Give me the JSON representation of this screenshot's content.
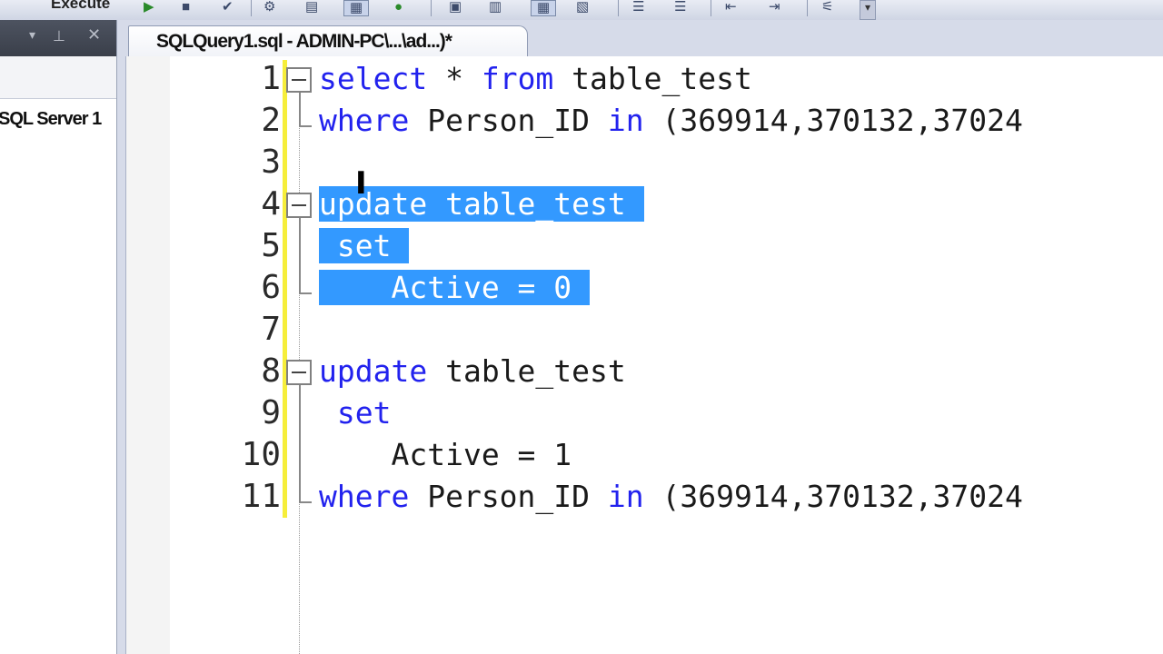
{
  "toolbar": {
    "execute_label": "Execute",
    "icons": [
      "run-icon",
      "stop-icon",
      "parse-icon",
      "check-icon",
      "db-icon",
      "grid-icon",
      "text-icon",
      "results-icon",
      "indent-icon",
      "outdent-icon",
      "comment-icon",
      "uncomment-icon",
      "specify-values-icon"
    ]
  },
  "left_panel": {
    "server_node": "SQL Server 1"
  },
  "tab": {
    "title": "SQLQuery1.sql - ADMIN-PC\\...\\ad...)*"
  },
  "editor": {
    "colors": {
      "keyword": "#2222ee",
      "selection": "#3399ff",
      "change_bar": "#f6ee3a"
    },
    "lines": [
      {
        "no": "1",
        "kw1": "select",
        "t1": " * ",
        "kw2": "from",
        "t2": " table_test",
        "selected": false
      },
      {
        "no": "2",
        "kw1": "where",
        "t1": " Person_ID ",
        "kw2": "in",
        "t2": " (369914,370132,37024",
        "selected": false
      },
      {
        "no": "3",
        "kw1": "",
        "t1": "",
        "kw2": "",
        "t2": "",
        "selected": false
      },
      {
        "no": "4",
        "kw1": "update",
        "t1": " table_test",
        "kw2": "",
        "t2": "",
        "selected": true
      },
      {
        "no": "5",
        "kw1": "set",
        "t1": "",
        "kw2": "",
        "t2": "",
        "selected": true
      },
      {
        "no": "6",
        "kw1": "",
        "t1": "Active = 0",
        "kw2": "",
        "t2": "",
        "selected": true
      },
      {
        "no": "7",
        "kw1": "",
        "t1": "",
        "kw2": "",
        "t2": "",
        "selected": false
      },
      {
        "no": "8",
        "kw1": "update",
        "t1": " table_test",
        "kw2": "",
        "t2": "",
        "selected": false
      },
      {
        "no": "9",
        "kw1": "set",
        "t1": "",
        "kw2": "",
        "t2": "",
        "selected": false
      },
      {
        "no": "10",
        "kw1": "",
        "t1": "Active = 1",
        "kw2": "",
        "t2": "",
        "selected": false
      },
      {
        "no": "11",
        "kw1": "where",
        "t1": " Person_ID ",
        "kw2": "in",
        "t2": " (369914,370132,37024",
        "selected": false
      }
    ]
  }
}
